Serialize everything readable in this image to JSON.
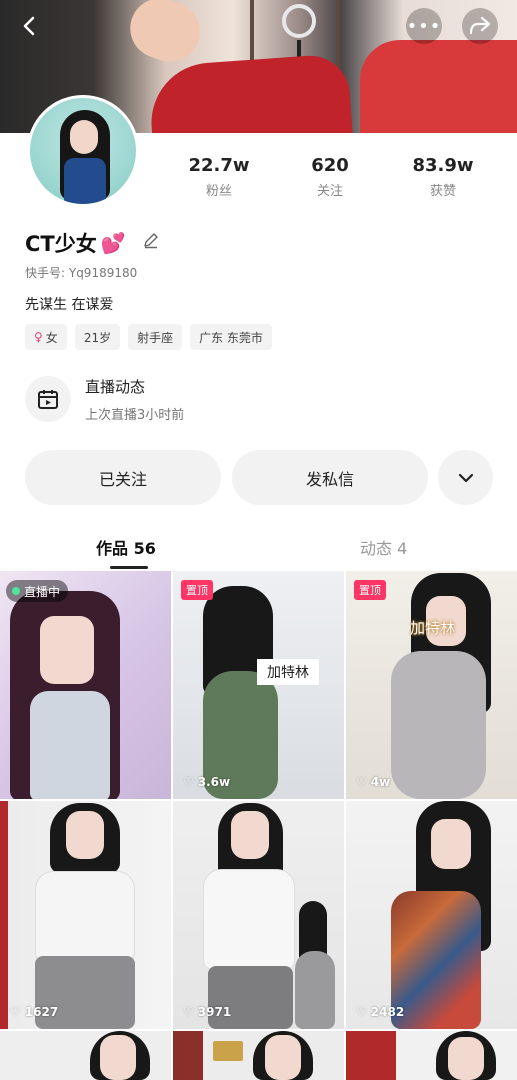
{
  "header": {
    "back_icon": "chevron-left-icon",
    "more_icon": "ellipsis-icon",
    "share_icon": "share-icon"
  },
  "profile": {
    "name": "CT少女",
    "name_emoji": "💕",
    "kuaishou_id": "快手号: Yq9189180",
    "bio": "先谋生 在谋爱",
    "stats": [
      {
        "value": "22.7w",
        "label": "粉丝"
      },
      {
        "value": "620",
        "label": "关注"
      },
      {
        "value": "83.9w",
        "label": "获赞"
      }
    ],
    "tags": {
      "gender": "女",
      "age": "21岁",
      "zodiac": "射手座",
      "location": "广东 东莞市"
    }
  },
  "live": {
    "title": "直播动态",
    "subtitle": "上次直播3小时前"
  },
  "actions": {
    "follow_label": "已关注",
    "message_label": "发私信"
  },
  "tabs": {
    "works": "作品 56",
    "moments": "动态 4"
  },
  "grid": {
    "live_badge": "直播中",
    "pinned_badge": "置顶",
    "overlay_text": "加特林",
    "likes": [
      "3.6w",
      "4w",
      "1627",
      "3971",
      "2482"
    ]
  },
  "colors": {
    "accent": "#fe3666",
    "button_bg": "#f2f2f2",
    "live_dot": "#4fe3a0"
  }
}
